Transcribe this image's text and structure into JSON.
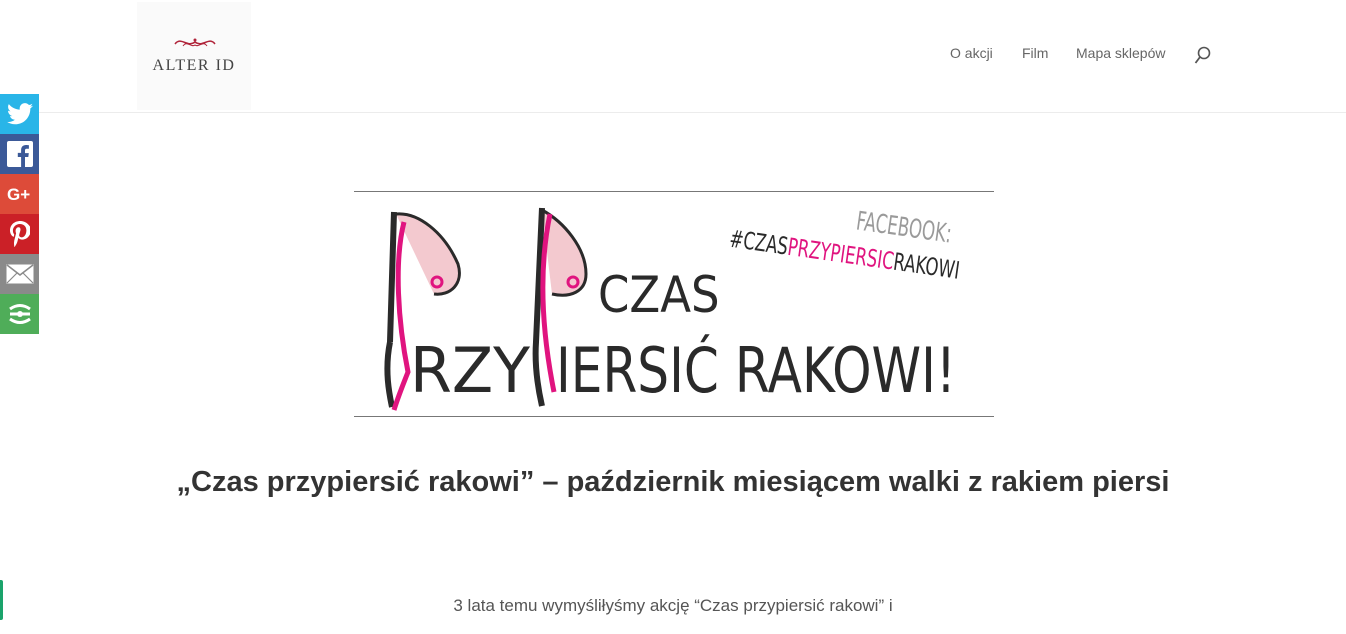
{
  "header": {
    "logo_text": "ALTER ID",
    "nav": [
      {
        "label": "O akcji"
      },
      {
        "label": "Film"
      },
      {
        "label": "Mapa sklepów"
      }
    ]
  },
  "share": [
    {
      "name": "twitter",
      "icon": "twitter-icon",
      "color": "#29b5e8"
    },
    {
      "name": "facebook",
      "icon": "facebook-icon",
      "color": "#3b5998"
    },
    {
      "name": "google-plus",
      "icon": "google-plus-icon",
      "color": "#dd4b39"
    },
    {
      "name": "pinterest",
      "icon": "pinterest-icon",
      "color": "#cb2027"
    },
    {
      "name": "email",
      "icon": "mail-icon",
      "color": "#8a8a8a"
    },
    {
      "name": "more",
      "icon": "share-more-icon",
      "color": "#4fad59"
    }
  ],
  "banner": {
    "facebook_label": "FACEBOOK:",
    "hashtag_prefix": "#CZAS",
    "hashtag_highlight": "PRZYPIERSIC",
    "hashtag_suffix": "RAKOWI",
    "line1": "CZAS",
    "line2": "RZY",
    "line3": "IERSIĆ RAKOWI!",
    "accent_color": "#e0147f"
  },
  "article": {
    "title": "„Czas przypiersić rakowi” – październik miesiącem walki z rakiem piersi",
    "intro": "3 lata temu wymyśliłyśmy akcję “Czas przypiersić rakowi” i"
  }
}
